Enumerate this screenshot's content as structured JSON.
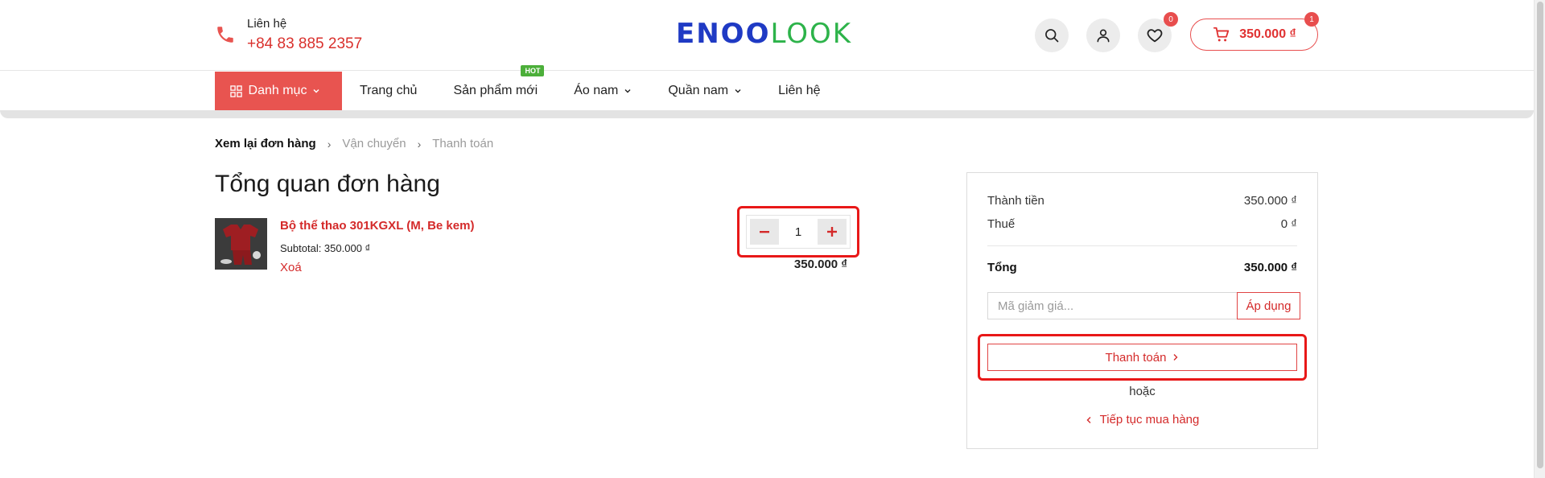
{
  "header": {
    "contact_label": "Liên hệ",
    "contact_phone": "+84 83 885 2357",
    "logo_part1": "ENOO",
    "logo_part2": "LOOK",
    "wishlist_count": "0",
    "cart_count": "1",
    "cart_total": "350.000 ₫"
  },
  "nav": {
    "category_label": "Danh mục",
    "items": [
      "Trang chủ",
      "Sản phẩm mới",
      "Áo nam",
      "Quần nam",
      "Liên hệ"
    ],
    "hot_badge": "HOT"
  },
  "breadcrumb": {
    "steps": [
      "Xem lại đơn hàng",
      "Vận chuyển",
      "Thanh toán"
    ]
  },
  "page_title": "Tổng quan đơn hàng",
  "product": {
    "name": "Bộ thể thao 301KGXL (M, Be kem)",
    "subtotal": "Subtotal: 350.000 ₫",
    "remove_label": "Xoá",
    "quantity": "1",
    "line_total": "350.000 ₫"
  },
  "summary": {
    "subtotal_label": "Thành tiền",
    "subtotal_value": "350.000 ₫",
    "tax_label": "Thuế",
    "tax_value": "0 ₫",
    "total_label": "Tổng",
    "total_value": "350.000 ₫",
    "coupon_placeholder": "Mã giảm giá...",
    "apply_label": "Áp dụng",
    "checkout_label": "Thanh toán",
    "or_label": "hoặc",
    "continue_label": "Tiếp tục mua hàng"
  },
  "colors": {
    "accent": "#e85450",
    "link_red": "#d42a2a",
    "logo_blue": "#1f3ac4",
    "logo_green": "#2db34a",
    "highlight": "#e81818"
  }
}
